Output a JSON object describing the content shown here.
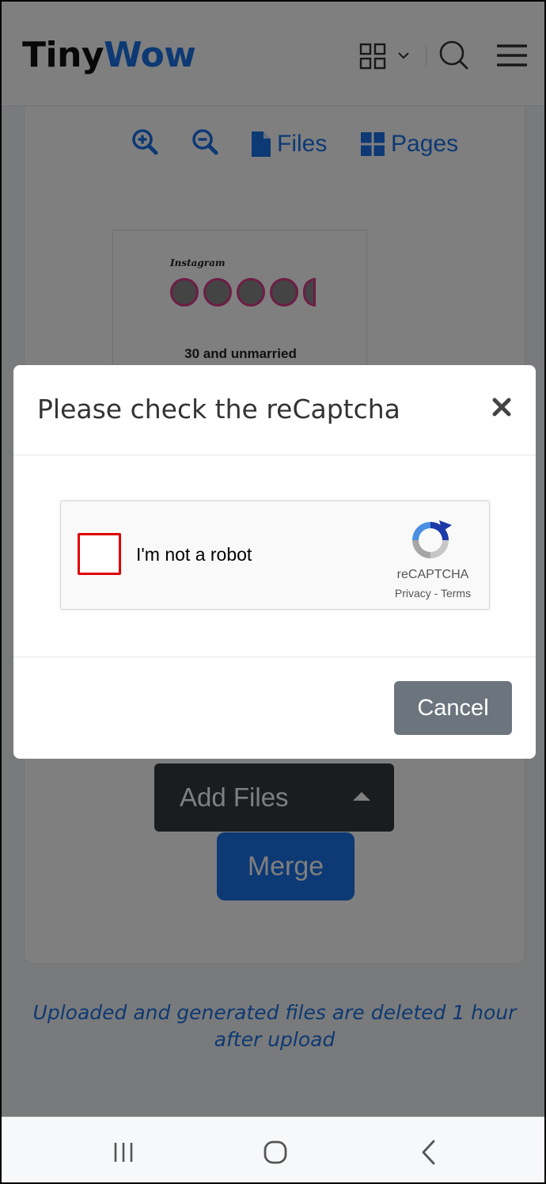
{
  "header": {
    "logo_part1": "Tiny",
    "logo_part2": "Wow",
    "icons": [
      "apps-grid-icon",
      "chevron-down-icon",
      "search-icon",
      "hamburger-menu-icon"
    ]
  },
  "toolbar": {
    "files_label": "Files",
    "pages_label": "Pages",
    "icons": [
      "zoom-in-icon",
      "zoom-out-icon",
      "file-icon",
      "pages-grid-icon"
    ]
  },
  "preview": {
    "caption": "30 and unmarried",
    "app_name": "Instagram"
  },
  "actions": {
    "add_files_label": "Add Files",
    "merge_label": "Merge"
  },
  "footnote": "Uploaded and generated files are deleted 1 hour after upload",
  "modal": {
    "title": "Please check the reCaptcha",
    "recaptcha": {
      "label": "I'm not a robot",
      "brand": "reCAPTCHA",
      "privacy": "Privacy",
      "separator": " - ",
      "terms": "Terms"
    },
    "cancel_label": "Cancel"
  },
  "colors": {
    "brand_blue": "#1a73e8",
    "dark_button": "#343a40",
    "secondary_button": "#6c757d",
    "checkbox_highlight": "#e00000"
  }
}
